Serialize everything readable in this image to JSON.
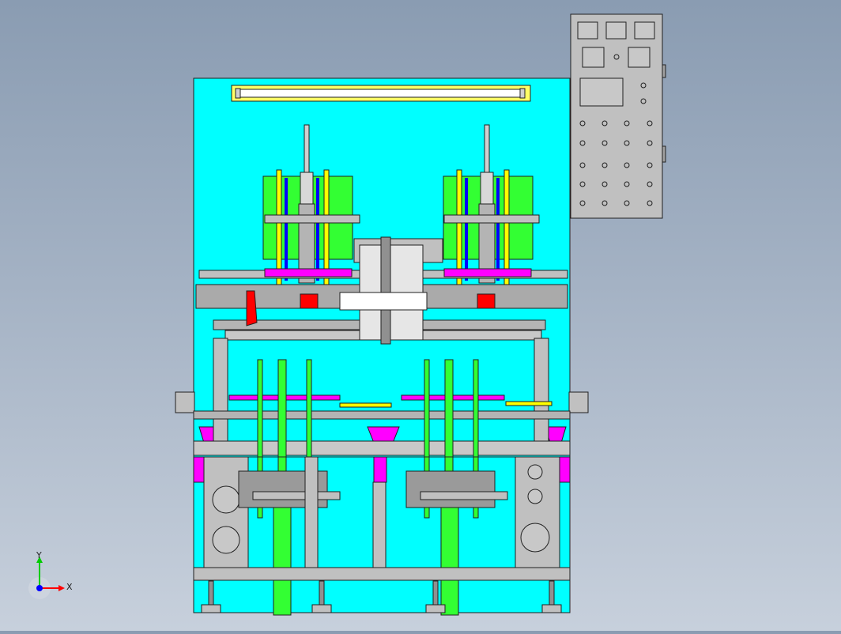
{
  "viewport": {
    "background_top": "#8a9cb2",
    "background_bottom": "#c7d0dc"
  },
  "colors": {
    "frame_cyan": "#00ffff",
    "panel_gray": "#c0c0c0",
    "steel_gray": "#b4b4b4",
    "green_part": "#33ff33",
    "magenta_part": "#ff00ff",
    "red_part": "#ff0000",
    "yellow_part": "#ffff00",
    "blue_part": "#0000ff",
    "line": "#202020"
  },
  "triad": {
    "x_label": "X",
    "y_label": "Y",
    "x_color": "#ff0000",
    "y_color": "#00cc00",
    "z_color": "#0000ff"
  },
  "control_panel": {
    "icon": "control-panel-icon",
    "button_rows": 5,
    "button_cols": 4
  }
}
